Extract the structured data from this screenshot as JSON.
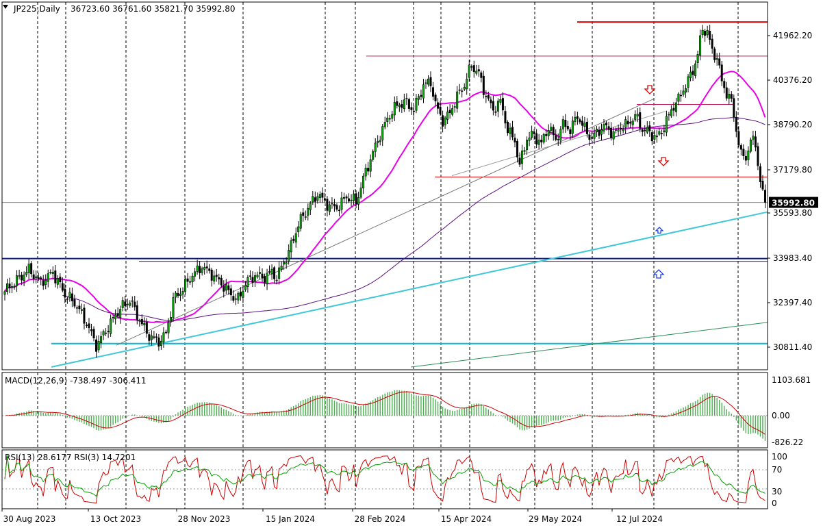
{
  "header": {
    "title": "JP225,Daily",
    "ohlc": "36723.60 36761.60 35821.70 35992.80"
  },
  "chart_data": {
    "type": "candlestick",
    "symbol": "JP225",
    "timeframe": "Daily",
    "current_price": 35992.8,
    "current_price_label": "35992.80",
    "price_axis_labels": [
      "41962.20",
      "40376.20",
      "38790.20",
      "37179.80",
      "35593.80",
      "33983.40",
      "32397.40",
      "30811.40"
    ],
    "price_axis_values": [
      41962.2,
      40376.2,
      38790.2,
      37179.8,
      35593.8,
      33983.4,
      32397.4,
      30811.4
    ],
    "date_labels": [
      "30 Aug 2023",
      "13 Oct 2023",
      "28 Nov 2023",
      "15 Jan 2024",
      "28 Feb 2024",
      "15 Apr 2024",
      "29 May 2024",
      "12 Jul 2024"
    ],
    "ylim": [
      30100,
      43100
    ],
    "close_path": [
      [
        0,
        32800
      ],
      [
        5,
        33200
      ],
      [
        10,
        33600
      ],
      [
        15,
        33100
      ],
      [
        20,
        33500
      ],
      [
        25,
        32700
      ],
      [
        30,
        32300
      ],
      [
        35,
        31500
      ],
      [
        38,
        30850
      ],
      [
        42,
        31400
      ],
      [
        47,
        32100
      ],
      [
        52,
        32500
      ],
      [
        56,
        31800
      ],
      [
        60,
        31200
      ],
      [
        64,
        31000
      ],
      [
        67,
        31300
      ],
      [
        70,
        32500
      ],
      [
        74,
        32900
      ],
      [
        78,
        33400
      ],
      [
        82,
        33700
      ],
      [
        86,
        33400
      ],
      [
        90,
        33100
      ],
      [
        94,
        32700
      ],
      [
        97,
        32500
      ],
      [
        100,
        33100
      ],
      [
        104,
        33400
      ],
      [
        108,
        33300
      ],
      [
        111,
        33500
      ],
      [
        113,
        33300
      ],
      [
        115,
        33700
      ],
      [
        118,
        34200
      ],
      [
        122,
        35200
      ],
      [
        126,
        35800
      ],
      [
        130,
        36300
      ],
      [
        134,
        35900
      ],
      [
        138,
        35800
      ],
      [
        142,
        36200
      ],
      [
        146,
        36000
      ],
      [
        150,
        37100
      ],
      [
        154,
        38000
      ],
      [
        158,
        38800
      ],
      [
        162,
        39400
      ],
      [
        166,
        39600
      ],
      [
        170,
        39300
      ],
      [
        174,
        40200
      ],
      [
        177,
        40300
      ],
      [
        179,
        39500
      ],
      [
        182,
        38900
      ],
      [
        185,
        39200
      ],
      [
        188,
        39800
      ],
      [
        191,
        40200
      ],
      [
        194,
        40900
      ],
      [
        197,
        40600
      ],
      [
        200,
        39800
      ],
      [
        203,
        39300
      ],
      [
        206,
        39600
      ],
      [
        209,
        38600
      ],
      [
        212,
        38200
      ],
      [
        214,
        37300
      ],
      [
        217,
        38300
      ],
      [
        220,
        38400
      ],
      [
        223,
        38100
      ],
      [
        226,
        38700
      ],
      [
        229,
        38200
      ],
      [
        232,
        38800
      ],
      [
        235,
        38600
      ],
      [
        238,
        39100
      ],
      [
        241,
        38600
      ],
      [
        244,
        38300
      ],
      [
        247,
        38600
      ],
      [
        250,
        38700
      ],
      [
        253,
        38400
      ],
      [
        256,
        38700
      ],
      [
        259,
        38800
      ],
      [
        262,
        39100
      ],
      [
        265,
        38600
      ],
      [
        268,
        38500
      ],
      [
        271,
        38300
      ],
      [
        274,
        38700
      ],
      [
        277,
        39300
      ],
      [
        280,
        39700
      ],
      [
        283,
        40200
      ],
      [
        286,
        40700
      ],
      [
        288,
        41300
      ],
      [
        290,
        42200
      ],
      [
        292,
        42100
      ],
      [
        294,
        41400
      ],
      [
        296,
        41200
      ],
      [
        298,
        40300
      ],
      [
        300,
        39900
      ],
      [
        302,
        39600
      ],
      [
        304,
        38600
      ],
      [
        306,
        37700
      ],
      [
        308,
        37600
      ],
      [
        310,
        38200
      ],
      [
        312,
        38100
      ],
      [
        314,
        36700
      ],
      [
        316,
        35993
      ]
    ],
    "indicators": {
      "macd": {
        "label": "MACD(12,26,9) -738.497 -306.411",
        "params": [
          12,
          26,
          9
        ],
        "main": -738.497,
        "signal": -306.411,
        "axis_labels": [
          "1103.681",
          "0.00",
          "-826.22"
        ],
        "axis_values": [
          1103.681,
          0,
          -826.22
        ]
      },
      "rsi": {
        "label": "RSI(13) 28.6177  RSI(3) 14.7201",
        "rsi13": 28.6177,
        "rsi3": 14.7201,
        "axis_labels": [
          "100",
          "70",
          "30",
          "0"
        ],
        "axis_values": [
          100,
          70,
          30,
          0
        ]
      }
    },
    "horizontal_levels": [
      {
        "value": 42450,
        "color": "#e00000"
      },
      {
        "value": 41230,
        "color": "#c2185b"
      },
      {
        "value": 39500,
        "color": "#c2185b"
      },
      {
        "value": 36900,
        "color": "#e00000"
      },
      {
        "value": 33983,
        "color": "#0a1c9a"
      },
      {
        "value": 30940,
        "color": "#00bcd4"
      }
    ],
    "grid": "vertical-dashed",
    "colors": {
      "bull": "#00b000",
      "bear": "#000000",
      "ma_fast": "#e800e8",
      "ma_slow": "#5a1080",
      "trend_cyan": "#40c8d8",
      "trend_green": "#2e8b57",
      "macd_hist": "#4caf50",
      "macd_signal": "#cc0000",
      "rsi13": "#00a000",
      "rsi3": "#cc0000",
      "arrow_down": "#e00000",
      "arrow_up": "#1a3fd8",
      "price_tag_bg": "#000000",
      "price_tag_fg": "#ffffff"
    }
  }
}
